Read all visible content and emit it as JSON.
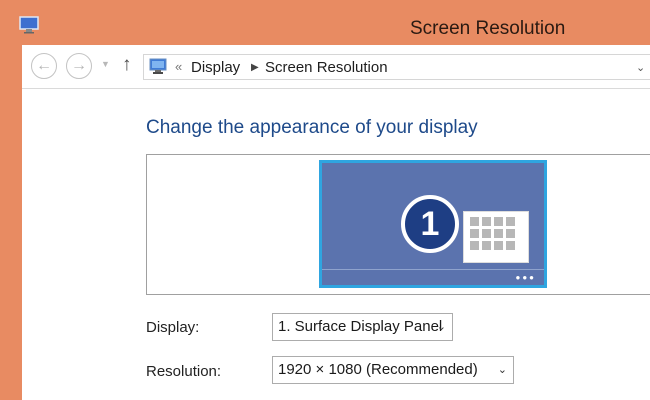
{
  "window": {
    "title": "Screen Resolution"
  },
  "navigation": {
    "back_icon": "back-arrow-icon",
    "forward_icon": "forward-arrow-icon",
    "recent_icon": "chevron-down-icon",
    "up_icon": "up-arrow-icon",
    "back_glyph": "←",
    "forward_glyph": "→",
    "recent_glyph": "▼",
    "up_glyph": "↑"
  },
  "address": {
    "chevrons": "«",
    "separator": "▶",
    "breadcrumbs": [
      "Display",
      "Screen Resolution"
    ],
    "dropdown_glyph": "⌄"
  },
  "main": {
    "heading": "Change the appearance of your display",
    "monitor_number": "1",
    "monitor_dots": "●●●"
  },
  "settings": {
    "display": {
      "label": "Display:",
      "value": "1. Surface Display Panel"
    },
    "resolution": {
      "label": "Resolution:",
      "value": "1920 × 1080 (Recommended)"
    },
    "select_arrow": "⌄"
  },
  "colors": {
    "title_bar": "#e88b62",
    "heading": "#1e4a8a",
    "monitor_border": "#2fa5e0",
    "monitor_screen": "#5b73ae"
  }
}
